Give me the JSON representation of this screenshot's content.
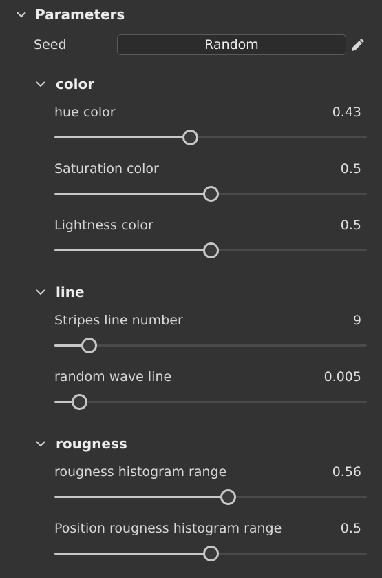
{
  "panel": {
    "title": "Parameters",
    "seed_label": "Seed",
    "seed_button": "Random",
    "edit_icon": "pencil-icon"
  },
  "sections": [
    {
      "title": "color",
      "params": [
        {
          "label": "hue color",
          "value": "0.43",
          "fraction": 0.435
        },
        {
          "label": "Saturation color",
          "value": "0.5",
          "fraction": 0.5
        },
        {
          "label": "Lightness color",
          "value": "0.5",
          "fraction": 0.5
        }
      ]
    },
    {
      "title": "line",
      "params": [
        {
          "label": "Stripes line number",
          "value": "9",
          "fraction": 0.11
        },
        {
          "label": "random wave line",
          "value": "0.005",
          "fraction": 0.08
        }
      ]
    },
    {
      "title": "rougness",
      "params": [
        {
          "label": "rougness histogram range",
          "value": "0.56",
          "fraction": 0.555
        },
        {
          "label": "Position rougness histogram range",
          "value": "0.5",
          "fraction": 0.5
        }
      ]
    }
  ],
  "colors": {
    "background": "#333333",
    "text": "#e6e6e6",
    "slider_fill": "#c8c8c8",
    "slider_track": "#4a4a4a"
  }
}
